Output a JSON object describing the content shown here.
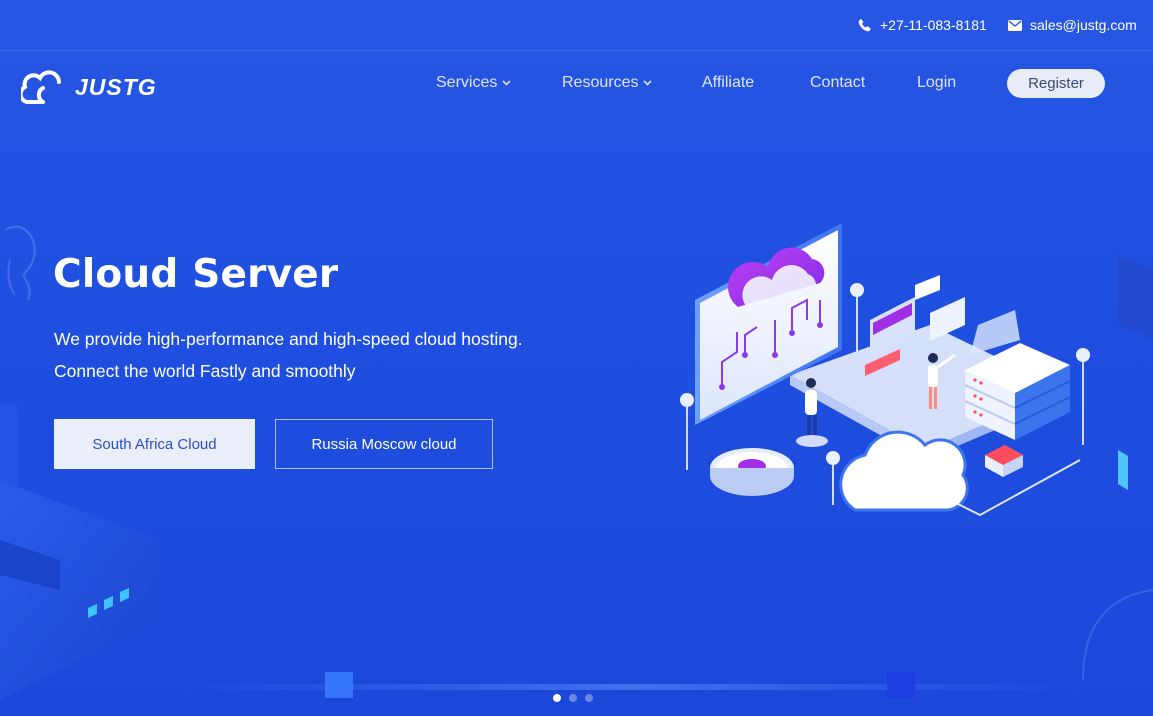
{
  "topbar": {
    "phone": "+27-11-083-8181",
    "email": "sales@justg.com",
    "phone_icon": "phone-icon",
    "email_icon": "envelope-icon"
  },
  "brand": {
    "logo_text": "JUSTG",
    "logo_icon": "cloud-logo-icon"
  },
  "nav": {
    "services": "Services",
    "resources": "Resources",
    "affiliate": "Affiliate",
    "contact": "Contact",
    "login": "Login",
    "register": "Register"
  },
  "hero": {
    "title": "Cloud Server",
    "line1": "We provide high-performance and high-speed cloud hosting.",
    "line2": "Connect the world Fastly and smoothly",
    "button_primary": "South Africa Cloud",
    "button_secondary": "Russia Moscow cloud"
  },
  "carousel": {
    "slides": 3,
    "active_slide": 1
  },
  "colors": {
    "background": "#1f4fe0",
    "accent_purple": "#a52cf0",
    "button_light": "#eaeef9",
    "register_bg": "#e8ecf7"
  }
}
